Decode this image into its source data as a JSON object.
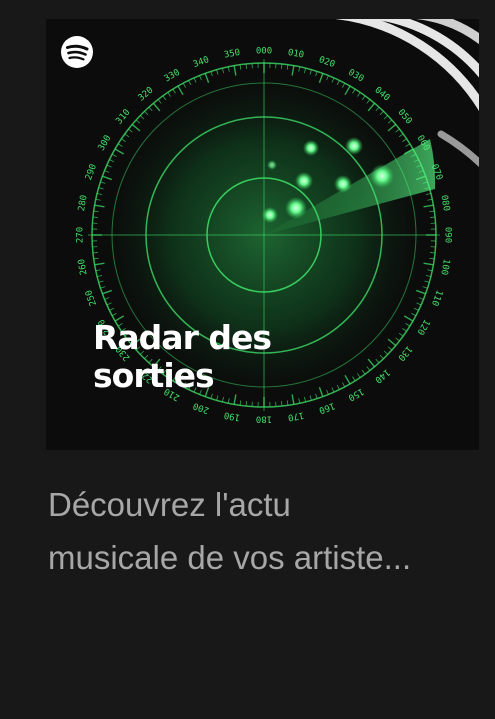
{
  "playlist": {
    "cover_title_line1": "Radar des",
    "cover_title_line2": "sorties",
    "description_line1": "Découvrez l'actu",
    "description_line2": "musicale de vos artiste...",
    "logo_icon": "spotify-logo-icon"
  },
  "radar_labels": [
    "000",
    "010",
    "020",
    "030",
    "040",
    "050",
    "060",
    "070",
    "080",
    "090",
    "100",
    "110",
    "120",
    "130",
    "140",
    "150",
    "160",
    "170",
    "180",
    "190",
    "200",
    "210",
    "220",
    "230",
    "240",
    "250",
    "260",
    "270",
    "280",
    "290",
    "300",
    "310",
    "320",
    "330",
    "340",
    "350"
  ],
  "colors": {
    "background": "#181818",
    "cover_bg": "#0b0c0b",
    "radar_green": "#3ddc66",
    "description": "#a7a7a7"
  }
}
